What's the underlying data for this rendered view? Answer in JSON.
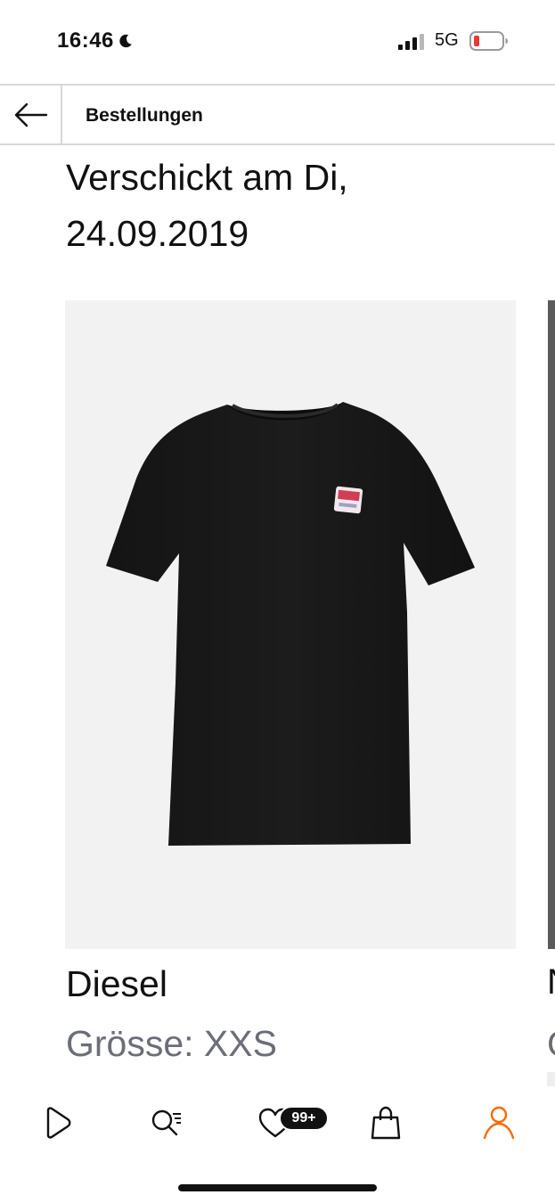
{
  "status_bar": {
    "time": "16:46",
    "moon_icon": "moon-icon",
    "network": "5G",
    "battery_color": "#e53935"
  },
  "header": {
    "back_icon": "arrow-left-icon",
    "title": "Bestellungen"
  },
  "order": {
    "shipped_heading": "Verschickt am Di, 24.09.2019"
  },
  "product": {
    "brand": "Diesel",
    "size_line": "Grösse: XXS",
    "image_description_icon": "tshirt-image"
  },
  "next_product_partial": {
    "brand_first_char": "N",
    "size_first_char": "G"
  },
  "tab_bar": {
    "tabs": [
      {
        "name": "play-icon"
      },
      {
        "name": "search-list-icon"
      },
      {
        "name": "heart-icon",
        "badge": "99+"
      },
      {
        "name": "shopping-bag-icon"
      },
      {
        "name": "profile-icon",
        "active": true
      }
    ],
    "active_color": "#ff6900"
  }
}
